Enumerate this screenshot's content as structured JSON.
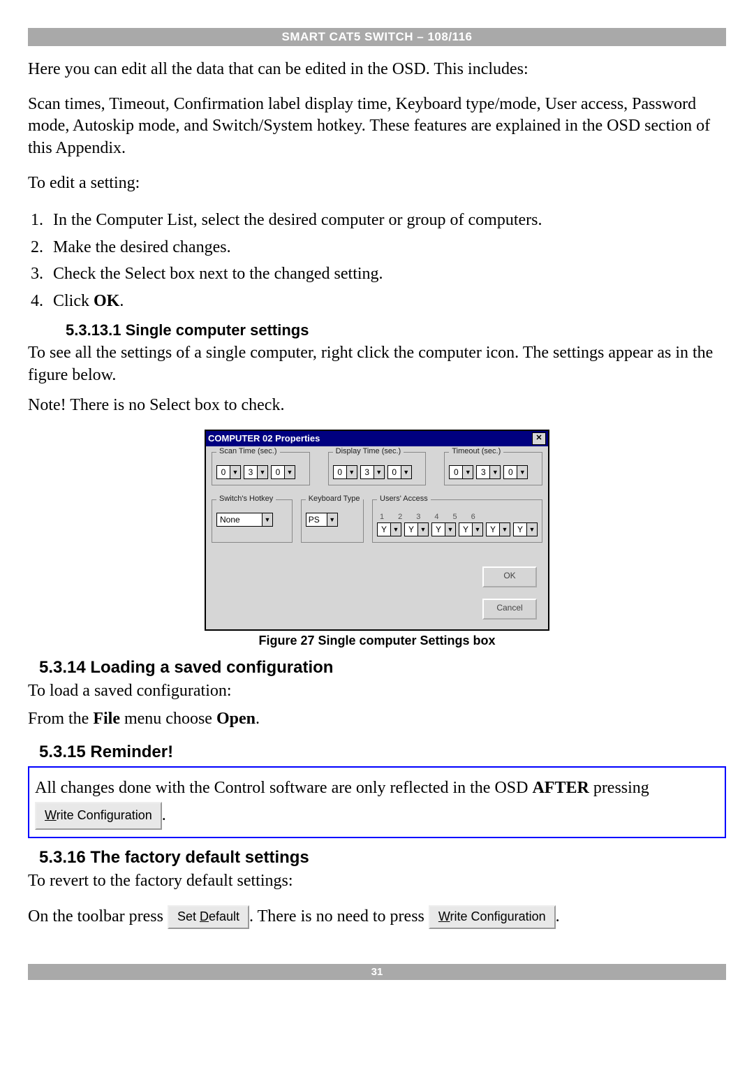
{
  "header": {
    "title": "SMART CAT5 SWITCH – 108/116"
  },
  "intro": {
    "p1": "Here you can edit all the data that can be edited in the OSD. This includes:",
    "p2": "Scan times, Timeout, Confirmation label display time, Keyboard type/mode, User access, Password mode, Autoskip mode, and Switch/System hotkey. These features are explained in the OSD section of this Appendix.",
    "p3": "To edit a setting:"
  },
  "steps": [
    "In the Computer List, select the desired computer or group of computers.",
    "Make the desired changes.",
    "Check the Select box next to the changed setting."
  ],
  "step4": {
    "prefix": "Click ",
    "bold": "OK",
    "suffix": "."
  },
  "section_single": {
    "heading": "5.3.13.1 Single computer settings",
    "p1": "To see all the settings of a single computer, right click the computer icon. The settings appear as in the figure below.",
    "p2": "Note! There is no Select box to check."
  },
  "dialog": {
    "title": "COMPUTER 02 Properties",
    "close": "✕",
    "groups": {
      "scan": {
        "label": "Scan Time (sec.)",
        "values": [
          "0",
          "3",
          "0"
        ]
      },
      "display": {
        "label": "Display Time (sec.)",
        "values": [
          "0",
          "3",
          "0"
        ]
      },
      "timeout": {
        "label": "Timeout (sec.)",
        "values": [
          "0",
          "3",
          "0"
        ]
      },
      "hotkey": {
        "label": "Switch's Hotkey",
        "value": "None"
      },
      "keyboard": {
        "label": "Keyboard Type",
        "value": "PS"
      },
      "users_access": {
        "label": "Users' Access",
        "cols": [
          "1",
          "2",
          "3",
          "4",
          "5",
          "6"
        ],
        "values": [
          "Y",
          "Y",
          "Y",
          "Y",
          "Y",
          "Y"
        ]
      }
    },
    "buttons": {
      "ok": "OK",
      "cancel": "Cancel"
    }
  },
  "fig27": "Figure 27 Single computer Settings box",
  "section_loading": {
    "heading": "5.3.14 Loading a saved configuration",
    "p1": "To load a saved configuration:",
    "p2": {
      "a": "From the ",
      "b": "File",
      "c": " menu choose ",
      "d": "Open",
      "e": "."
    }
  },
  "section_reminder": {
    "heading": "5.3.15 Reminder!",
    "line": {
      "a": "All changes done with the Control software are only reflected in the OSD ",
      "after": "AFTER",
      "b": " pressing ",
      "btn_u": "W",
      "btn_rest": "rite Configuration",
      "c": "."
    }
  },
  "section_factory": {
    "heading": "5.3.16 The factory default settings",
    "p1": "To revert to the factory default settings:",
    "line": {
      "a": "On the toolbar press ",
      "btn1_pre": "Set ",
      "btn1_u": "D",
      "btn1_post": "efault",
      "b": ". There is no need to press ",
      "btn2_u": "W",
      "btn2_rest": "rite Configuration",
      "c": "."
    }
  },
  "footer": {
    "page": "31"
  }
}
